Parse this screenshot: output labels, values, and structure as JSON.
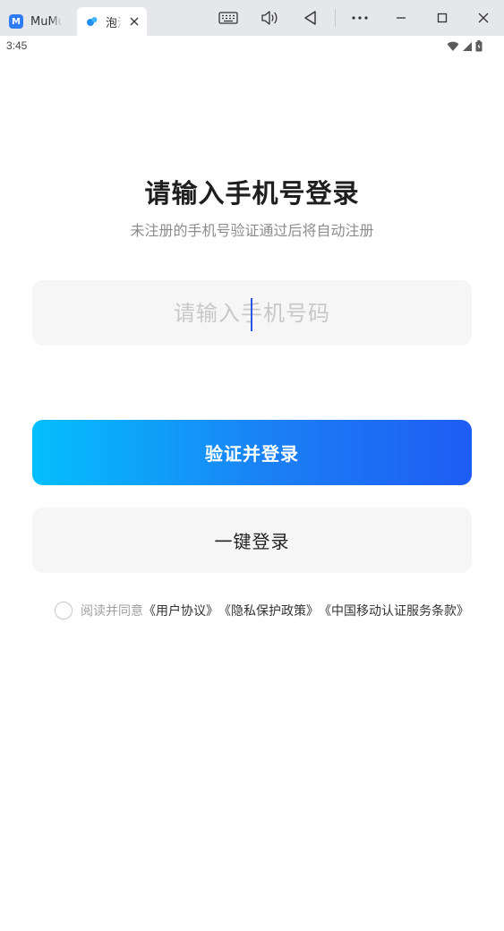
{
  "window": {
    "tabs": [
      {
        "title": "MuMu",
        "logo": "M",
        "icon": "mumu-logo-icon"
      },
      {
        "title": "泡泡",
        "icon": "app-bubble-icon",
        "close_icon": "close-icon"
      }
    ],
    "toolbar_icons": [
      "keyboard-icon",
      "volume-icon",
      "back-icon",
      "more-icon",
      "minimize-icon",
      "maximize-icon",
      "close-icon"
    ]
  },
  "status_bar": {
    "time": "3:45",
    "icons": [
      "wifi-icon",
      "signal-icon",
      "battery-icon"
    ]
  },
  "login": {
    "title": "请输入手机号登录",
    "subtitle": "未注册的手机号验证通过后将自动注册",
    "phone_input": {
      "placeholder": "请输入手机号码",
      "value": ""
    },
    "verify_button": "验证并登录",
    "one_click_button": "一键登录",
    "agreement": {
      "checked": false,
      "prefix": "阅读并同意",
      "links": [
        "《用户协议》",
        "《隐私保护政策》",
        "《中国移动认证服务条款》"
      ]
    }
  },
  "colors": {
    "primary_gradient_start": "#04bffd",
    "primary_gradient_end": "#1e5cf3",
    "caret": "#2458e6",
    "input_bg": "#f6f6f6"
  }
}
